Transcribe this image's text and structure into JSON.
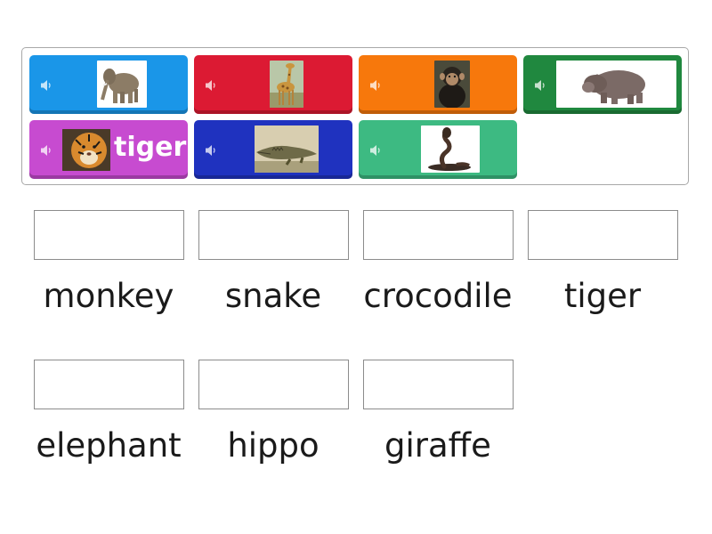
{
  "cards": [
    {
      "id": "elephant",
      "color": "#1a96e8",
      "icon": "elephant-picture",
      "sound_icon": "speaker-icon"
    },
    {
      "id": "giraffe",
      "color": "#dc1a33",
      "icon": "giraffe-picture",
      "sound_icon": "speaker-icon"
    },
    {
      "id": "chimp",
      "color": "#f7780c",
      "icon": "chimpanzee-picture",
      "sound_icon": "speaker-icon"
    },
    {
      "id": "hippo",
      "color": "#20883f",
      "icon": "hippo-picture",
      "sound_icon": "speaker-icon"
    },
    {
      "id": "tiger",
      "color": "#c74bd0",
      "icon": "tiger-picture",
      "sound_icon": "speaker-icon",
      "label": "tiger"
    },
    {
      "id": "crocodile",
      "color": "#1f32bf",
      "icon": "crocodile-picture",
      "sound_icon": "speaker-icon"
    },
    {
      "id": "snake",
      "color": "#3dba82",
      "icon": "cobra-picture",
      "sound_icon": "speaker-icon"
    }
  ],
  "slots": [
    {
      "label": "monkey"
    },
    {
      "label": "snake"
    },
    {
      "label": "crocodile"
    },
    {
      "label": "tiger"
    },
    {
      "label": "elephant"
    },
    {
      "label": "hippo"
    },
    {
      "label": "giraffe"
    }
  ]
}
